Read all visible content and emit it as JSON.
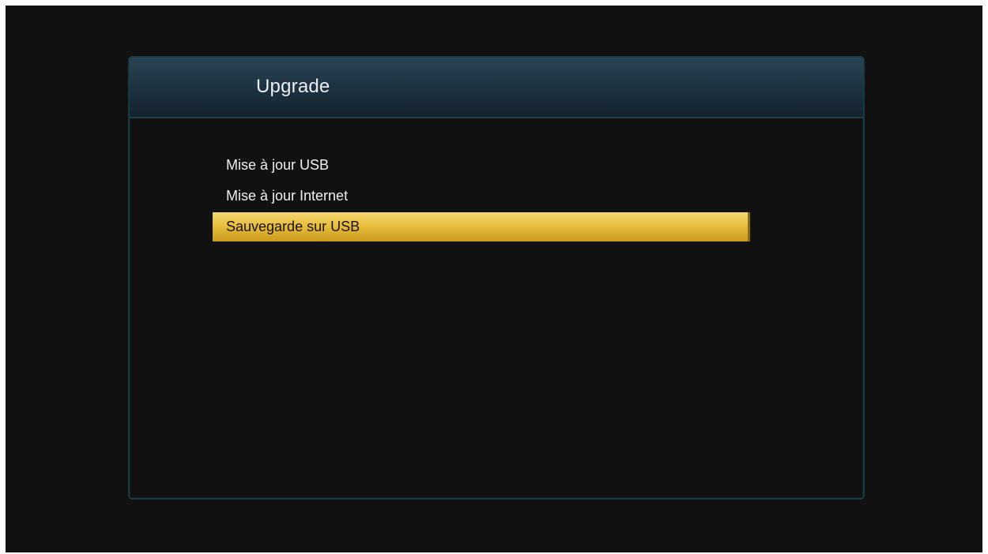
{
  "dialog": {
    "title": "Upgrade"
  },
  "menu": {
    "items": [
      {
        "label": "Mise à jour USB",
        "selected": false
      },
      {
        "label": "Mise à jour Internet",
        "selected": false
      },
      {
        "label": "Sauvegarde sur USB",
        "selected": true
      }
    ]
  },
  "colors": {
    "background": "#111111",
    "header": "#1f3443",
    "border": "#1a3a44",
    "highlight": "#e8bf3d",
    "text": "#f0f0f0"
  }
}
